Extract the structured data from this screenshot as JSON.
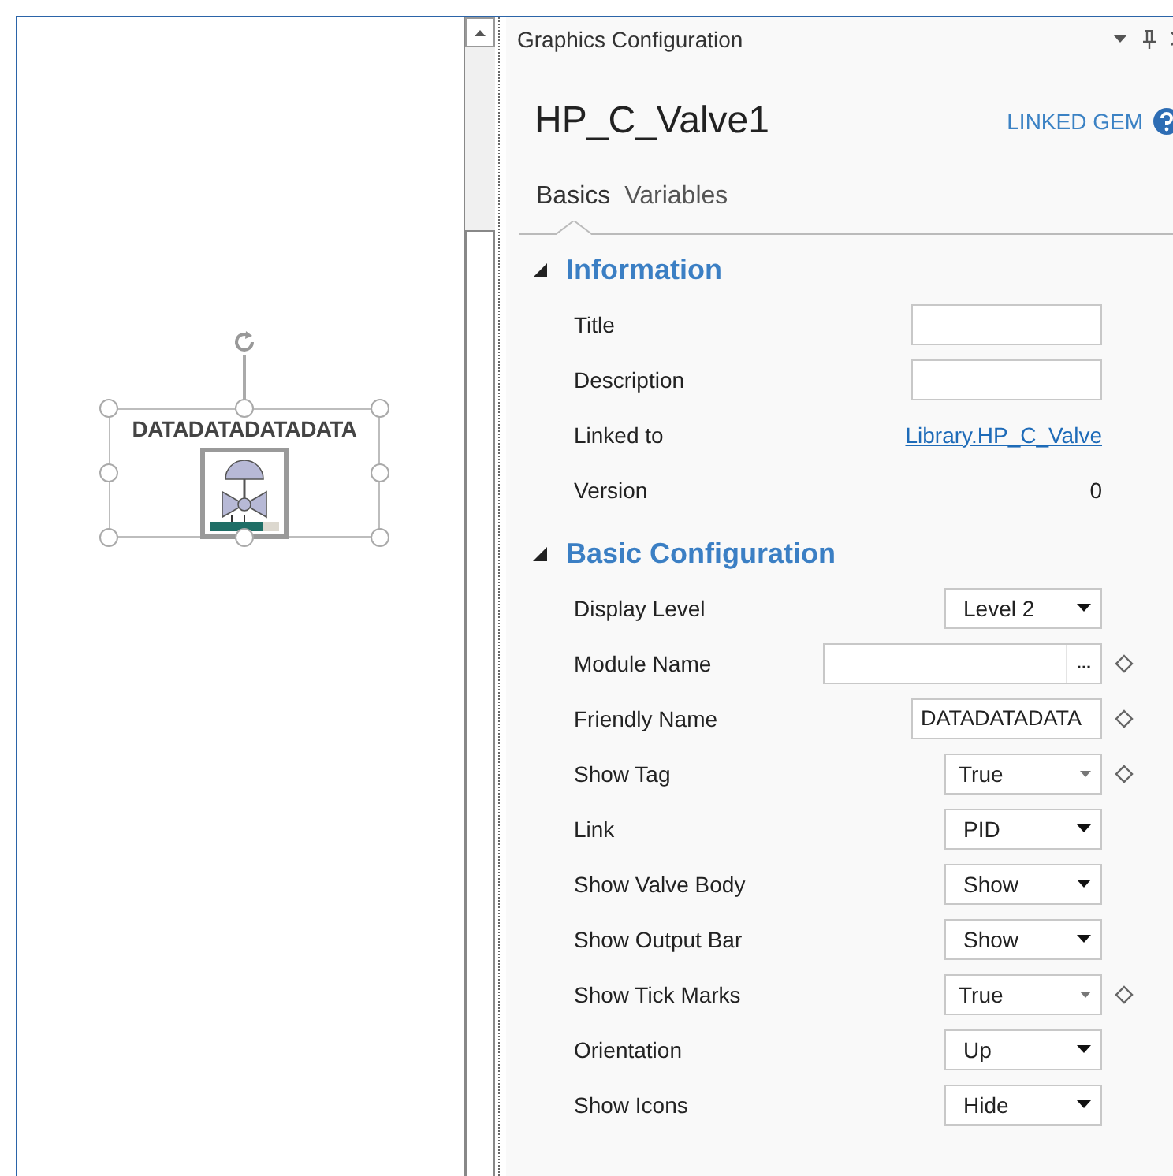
{
  "canvas": {
    "tag": "DATADATADATADATA",
    "selected": true
  },
  "panel": {
    "title": "Graphics Configuration"
  },
  "element": {
    "name": "HP_C_Valve1",
    "link_label": "LINKED GEM"
  },
  "tabs": [
    {
      "label": "Basics",
      "selected": true
    },
    {
      "label": "Variables",
      "selected": false
    }
  ],
  "sections": [
    {
      "title": "Information",
      "expanded": true,
      "rows": [
        {
          "kind": "text",
          "label": "Title",
          "marker": false
        },
        {
          "kind": "text",
          "label": "Description",
          "marker": false
        },
        {
          "kind": "link",
          "label": "Linked to",
          "value": "Library.HP_C_Valve",
          "marker": false
        },
        {
          "kind": "readonly",
          "label": "Version",
          "value": "0",
          "marker": false
        }
      ]
    },
    {
      "title": "Basic Configuration",
      "expanded": true,
      "rows": [
        {
          "kind": "dropdown",
          "label": "Display Level",
          "value": "Level 2",
          "marker": false
        },
        {
          "kind": "browse",
          "label": "Module Name",
          "button": "...",
          "marker": true
        },
        {
          "kind": "text",
          "label": "Friendly Name",
          "value": "DATADATADATA",
          "marker": true
        },
        {
          "kind": "combo",
          "label": "Show Tag",
          "value": "True",
          "marker": true
        },
        {
          "kind": "dropdown",
          "label": "Link",
          "value": "PID",
          "marker": false
        },
        {
          "kind": "dropdown",
          "label": "Show Valve Body",
          "value": "Show",
          "marker": false
        },
        {
          "kind": "dropdown",
          "label": "Show Output Bar",
          "value": "Show",
          "marker": false
        },
        {
          "kind": "combo",
          "label": "Show Tick Marks",
          "value": "True",
          "marker": true
        },
        {
          "kind": "dropdown",
          "label": "Orientation",
          "value": "Up",
          "marker": false
        },
        {
          "kind": "dropdown",
          "label": "Show Icons",
          "value": "Hide",
          "marker": false
        }
      ]
    }
  ]
}
